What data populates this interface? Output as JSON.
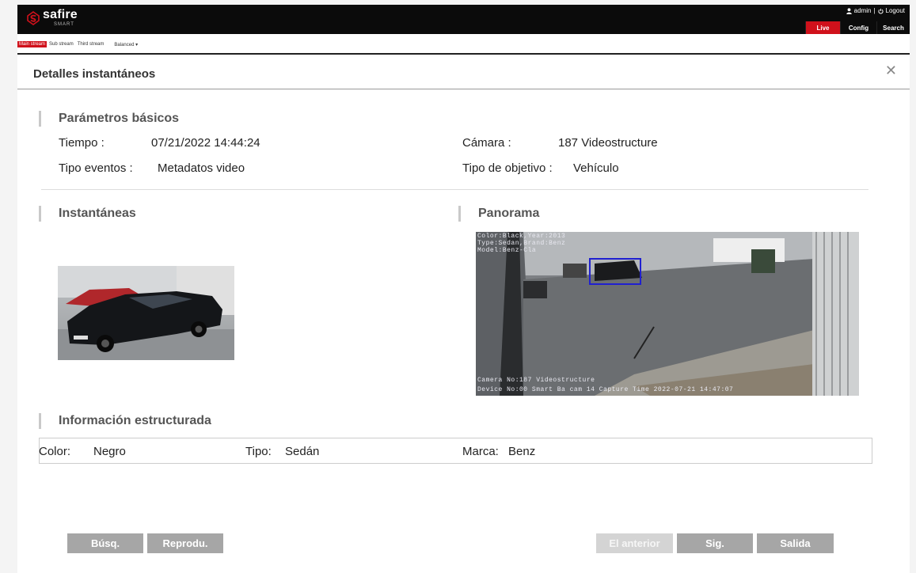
{
  "brand": {
    "name": "safire",
    "sub": "SMART",
    "accent": "#d0111b"
  },
  "header": {
    "user": "admin",
    "separator": "|",
    "logout": "Logout",
    "nav": [
      "Live",
      "Config",
      "Search"
    ]
  },
  "streams": {
    "tabs": [
      "Main stream",
      "Sub stream",
      "Third stream"
    ],
    "quality": "Balanced"
  },
  "panel": {
    "title": "Detalles instantáneos",
    "basic": {
      "heading": "Parámetros básicos",
      "time_label": "Tiempo :",
      "time_value": "07/21/2022 14:44:24",
      "camera_label": "Cámara :",
      "camera_value": "187 Videostructure",
      "event_label": "Tipo eventos :",
      "event_value": "Metadatos video",
      "target_label": "Tipo de objetivo :",
      "target_value": "Vehículo"
    },
    "snapshots_heading": "Instantáneas",
    "panorama": {
      "heading": "Panorama",
      "overlay_top": [
        "Color:Black,Year:2013",
        "Type:Sedan,Brand:Benz",
        "Model:Benz-Cla"
      ],
      "overlay_bottom": [
        "Camera No:187 Videostructure",
        "Device No:00 Smart Ba cam 14 Capture Time 2022-07-21 14:47:07"
      ]
    },
    "structured": {
      "heading": "Información estructurada",
      "color_label": "Color:",
      "color_value": "Negro",
      "type_label": "Tipo:",
      "type_value": "Sedán",
      "brand_label": "Marca:",
      "brand_value": "Benz"
    },
    "buttons": {
      "search": "Búsq.",
      "play": "Reprodu.",
      "prev": "El anterior",
      "next": "Sig.",
      "exit": "Salida"
    }
  }
}
